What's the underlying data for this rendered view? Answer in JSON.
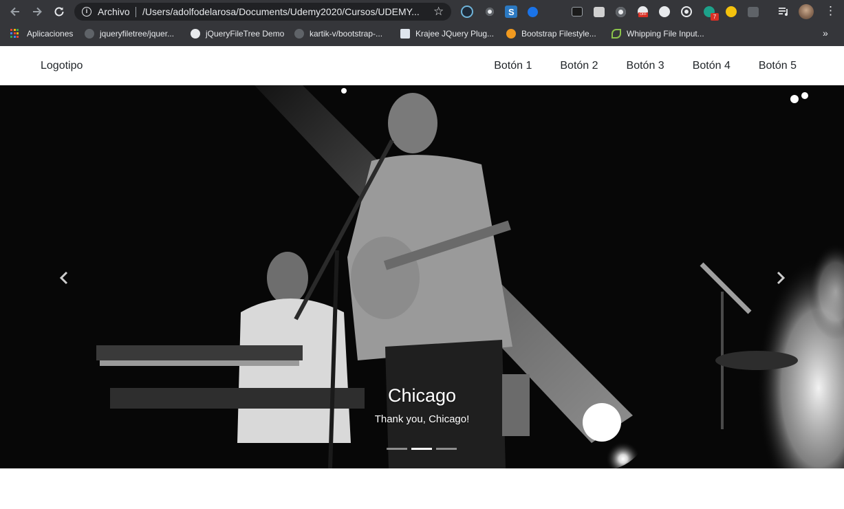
{
  "browser": {
    "address_scheme": "Archivo",
    "url": "/Users/adolfodelarosa/Documents/Udemy2020/Cursos/UDEMY...",
    "bookmarks": [
      {
        "label": "Aplicaciones",
        "icon": "apps-grid-icon"
      },
      {
        "label": "jqueryfiletree/jquer...",
        "icon": "github-icon"
      },
      {
        "label": "jQueryFileTree Demo",
        "icon": "globe-icon"
      },
      {
        "label": "kartik-v/bootstrap-...",
        "icon": "github-icon"
      },
      {
        "label": "Krajee JQuery Plug...",
        "icon": "krajee-icon"
      },
      {
        "label": "Bootstrap Filestyle...",
        "icon": "orange-fruit-icon"
      },
      {
        "label": "Whipping File Input...",
        "icon": "leaf-icon"
      }
    ],
    "extension_badge_count": "7",
    "off_badge": "OFF"
  },
  "navbar": {
    "logo": "Logotipo",
    "links": [
      "Botón 1",
      "Botón 2",
      "Botón 3",
      "Botón 4",
      "Botón 5"
    ]
  },
  "carousel": {
    "slide_title": "Chicago",
    "slide_text": "Thank you, Chicago!",
    "indicator_count": 3,
    "active_indicator": 2
  },
  "colors": {
    "chrome_bg": "#35363a",
    "omnibox_bg": "#202124",
    "nav_text": "#212529",
    "carousel_bg": "#050505"
  }
}
